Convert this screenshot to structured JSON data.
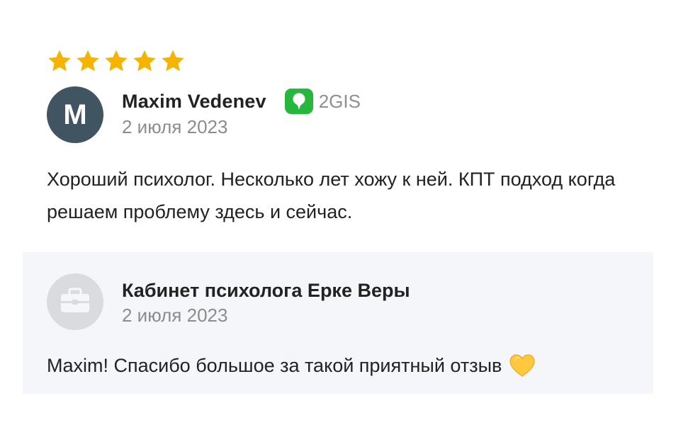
{
  "review": {
    "rating": 5,
    "rating_max": 5,
    "author": {
      "initial": "M",
      "name": "Maxim Vedenev"
    },
    "source": {
      "label": "2GIS",
      "icon": "2gis-logo-icon"
    },
    "date": "2 июля 2023",
    "text": "Хороший психолог. Несколько лет хожу к ней. КПТ подход когда решаем проблему здесь и сейчас."
  },
  "reply": {
    "icon": "briefcase-icon",
    "org_name": "Кабинет психолога Ерке Веры",
    "date": "2 июля 2023",
    "text": "Maxim! Спасибо большое за такой приятный отзыв",
    "emoji": "yellow-heart-icon"
  },
  "colors": {
    "star": "#F6B400",
    "avatar_bg": "#415462",
    "source_green": "#25B83D",
    "reply_bg": "#F5F6F9",
    "muted_text": "#8C8C8C",
    "heart": "#FFC83D"
  }
}
